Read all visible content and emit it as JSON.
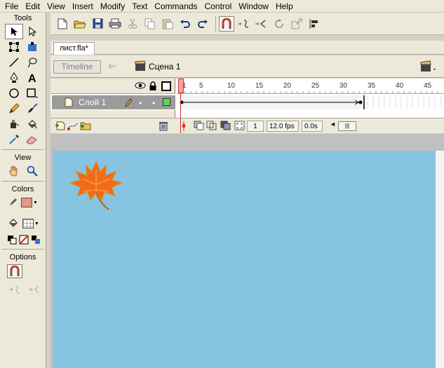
{
  "menubar": {
    "items": [
      "File",
      "Edit",
      "View",
      "Insert",
      "Modify",
      "Text",
      "Commands",
      "Control",
      "Window",
      "Help"
    ]
  },
  "toolbar": {
    "icons": [
      "new-document-icon",
      "open-icon",
      "save-icon",
      "print-icon",
      "cut-icon",
      "copy-icon",
      "paste-icon",
      "undo-icon",
      "redo-icon",
      "snap-magnet-icon",
      "smooth-icon",
      "straighten-icon",
      "rotate-icon",
      "scale-icon",
      "align-icon"
    ]
  },
  "tools_panel": {
    "title": "Tools",
    "view_label": "View",
    "colors_label": "Colors",
    "options_label": "Options",
    "colors": {
      "stroke": "#e8958a",
      "fill_pattern": "none"
    }
  },
  "document": {
    "tab_label": "лист.fla*"
  },
  "editbar": {
    "timeline_button": "Timeline",
    "scene_label": "Сцена 1"
  },
  "timeline": {
    "layer_name": "Слой 1",
    "ruler_ticks": [
      "1",
      "5",
      "10",
      "15",
      "20",
      "25",
      "30",
      "35",
      "40",
      "45"
    ],
    "current_frame": "1",
    "frame_rate": "12.0 fps",
    "elapsed_time": "0.0s",
    "tween_end_frame": 33,
    "layer_color": "#55dd55"
  },
  "stage": {
    "background": "#87c4e0"
  }
}
